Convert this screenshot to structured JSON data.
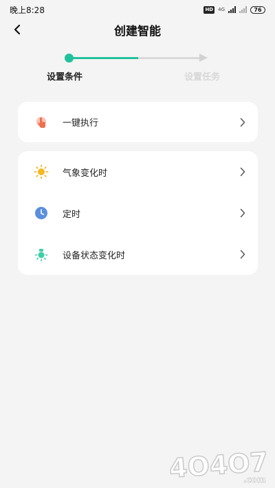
{
  "status_bar": {
    "time": "晚上8:28",
    "hd_badge": "HD",
    "network": "4G",
    "battery": "76"
  },
  "header": {
    "title": "创建智能",
    "back_icon": "chevron-left-icon"
  },
  "stepper": {
    "steps": [
      {
        "label": "设置条件",
        "state": "active"
      },
      {
        "label": "设置任务",
        "state": "inactive"
      }
    ],
    "active_color": "#20c29b",
    "inactive_color": "#d9d9d9"
  },
  "manual_group": {
    "items": [
      {
        "label": "一键执行",
        "icon": "tap-hand-icon",
        "icon_color": "#f07a5e"
      }
    ]
  },
  "condition_group": {
    "items": [
      {
        "label": "气象变化时",
        "icon": "sun-icon",
        "icon_color": "#f5b722"
      },
      {
        "label": "定时",
        "icon": "clock-icon",
        "icon_color": "#5b8fde"
      },
      {
        "label": "设备状态变化时",
        "icon": "device-light-icon",
        "icon_color": "#3ecfa8"
      }
    ]
  },
  "watermark": {
    "text": "4O4O7",
    "suffix": ".com"
  }
}
